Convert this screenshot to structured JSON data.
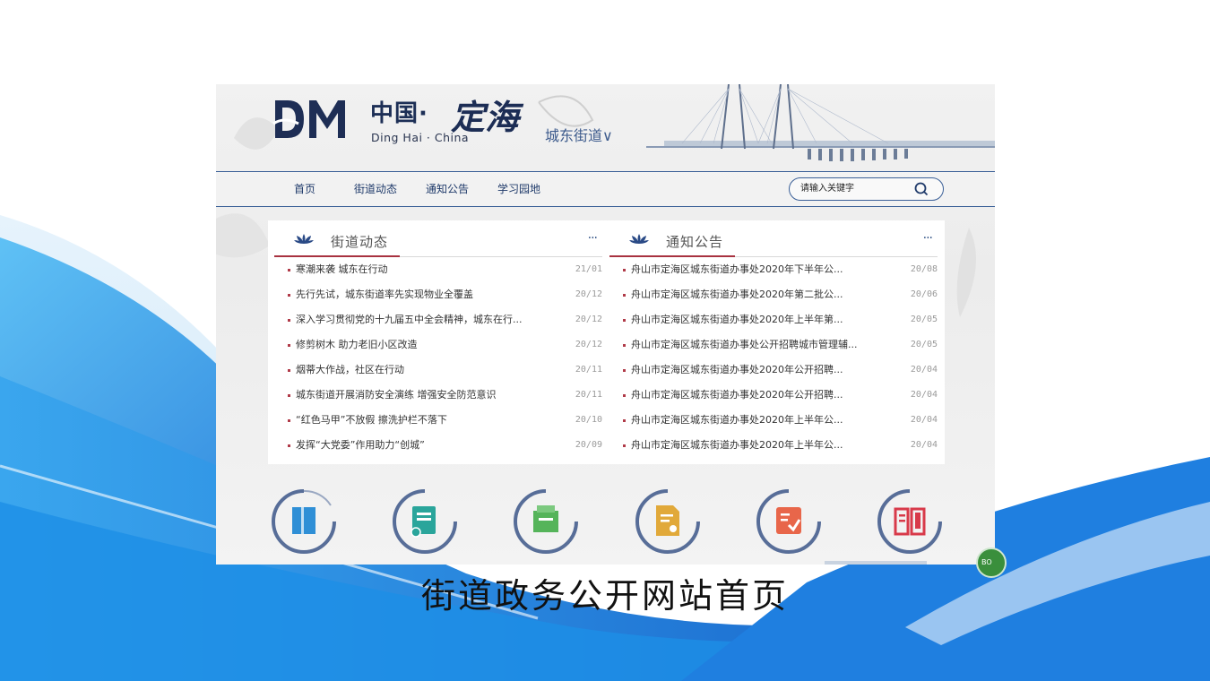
{
  "header": {
    "logo_cn": "中国·",
    "logo_calligraphy": "定海",
    "logo_en": "Ding Hai · China",
    "district_selector": "城东街道∨"
  },
  "nav": {
    "items": [
      "首页",
      "街道动态",
      "通知公告",
      "学习园地"
    ],
    "search_placeholder": "请输入关键字"
  },
  "panels": {
    "street_news": {
      "title": "街道动态",
      "more": "···",
      "items": [
        {
          "title": "寒潮来袭 城东在行动",
          "date": "21/01"
        },
        {
          "title": "先行先试，城东街道率先实现物业全覆盖",
          "date": "20/12"
        },
        {
          "title": "深入学习贯彻党的十九届五中全会精神，城东在行...",
          "date": "20/12"
        },
        {
          "title": "修剪树木 助力老旧小区改造",
          "date": "20/12"
        },
        {
          "title": "烟蒂大作战，社区在行动",
          "date": "20/11"
        },
        {
          "title": "城东街道开展消防安全演练 增强安全防范意识",
          "date": "20/11"
        },
        {
          "title": "“红色马甲”不放假 擦洗护栏不落下",
          "date": "20/10"
        },
        {
          "title": "发挥“大党委”作用助力“创城”",
          "date": "20/09"
        }
      ]
    },
    "notices": {
      "title": "通知公告",
      "more": "···",
      "items": [
        {
          "title": "舟山市定海区城东街道办事处2020年下半年公...",
          "date": "20/08"
        },
        {
          "title": "舟山市定海区城东街道办事处2020年第二批公...",
          "date": "20/06"
        },
        {
          "title": "舟山市定海区城东街道办事处2020年上半年第...",
          "date": "20/05"
        },
        {
          "title": "舟山市定海区城东街道办事处公开招聘城市管理辅...",
          "date": "20/05"
        },
        {
          "title": "舟山市定海区城东街道办事处2020年公开招聘...",
          "date": "20/04"
        },
        {
          "title": "舟山市定海区城东街道办事处2020年公开招聘...",
          "date": "20/04"
        },
        {
          "title": "舟山市定海区城东街道办事处2020年上半年公...",
          "date": "20/04"
        },
        {
          "title": "舟山市定海区城东街道办事处2020年上半年公...",
          "date": "20/04"
        }
      ]
    }
  },
  "quick_links": [
    {
      "icon": "book-icon",
      "color": "#2f8fd6"
    },
    {
      "icon": "certificate-icon",
      "color": "#2aa59b"
    },
    {
      "icon": "inbox-icon",
      "color": "#55b45a"
    },
    {
      "icon": "document-user-icon",
      "color": "#e1a93a"
    },
    {
      "icon": "checklist-icon",
      "color": "#e8664a"
    },
    {
      "icon": "open-book-icon",
      "color": "#d83a4a"
    }
  ],
  "corner_badge": "BO",
  "caption": "街道政务公开网站首页",
  "colors": {
    "wave_blue": "#1b78d8",
    "nav_blue": "#1f3a6a",
    "accent_red": "#a83240"
  }
}
